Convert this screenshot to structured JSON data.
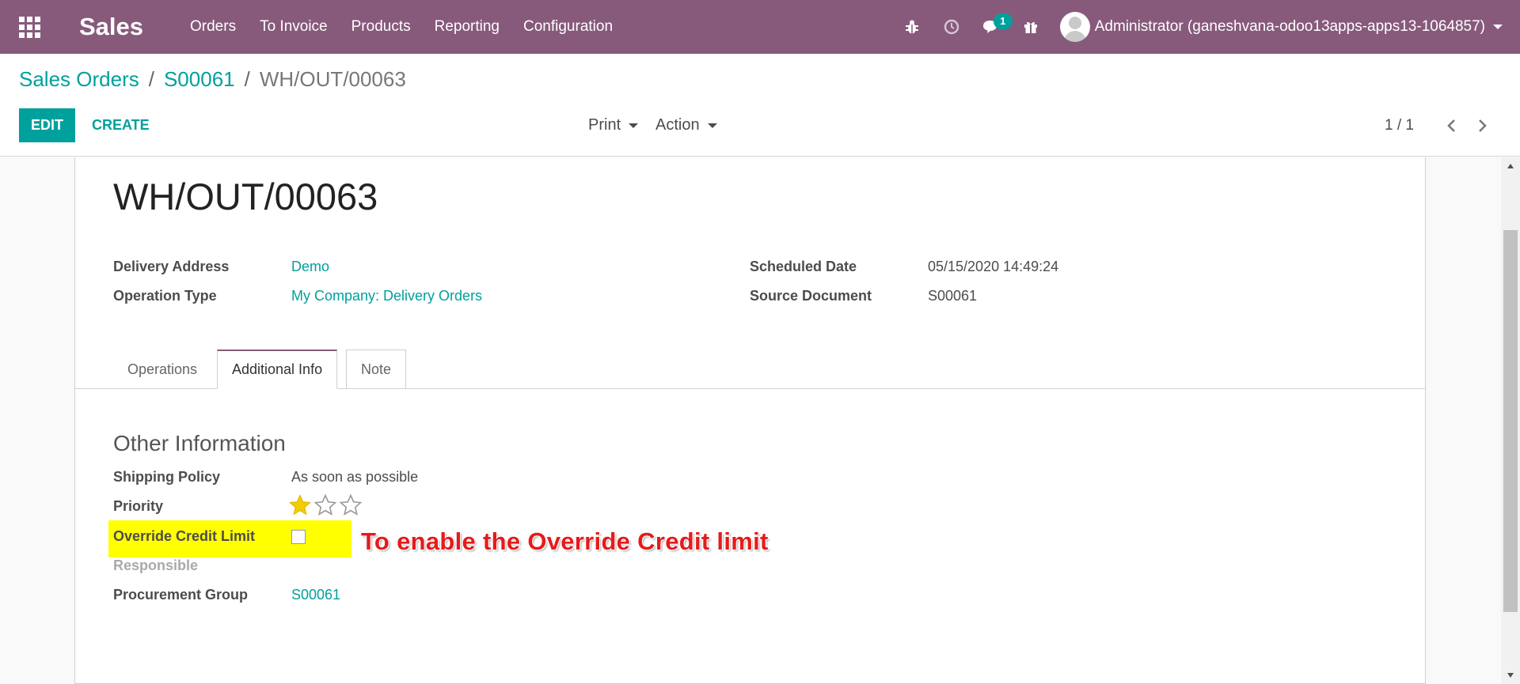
{
  "colors": {
    "brand": "#875a7b",
    "accent": "#00a09d",
    "highlight": "#ffff00",
    "annotation": "#e51b1b"
  },
  "navbar": {
    "app_name": "Sales",
    "menu": [
      "Orders",
      "To Invoice",
      "Products",
      "Reporting",
      "Configuration"
    ],
    "chat_badge": "1",
    "user_label": "Administrator (ganeshvana-odoo13apps-apps13-1064857)",
    "icons": [
      "apps-grid-icon",
      "bug-icon",
      "clock-icon",
      "chat-icon",
      "gift-icon",
      "avatar-icon"
    ]
  },
  "control": {
    "breadcrumb": [
      "Sales Orders",
      "S00061",
      "WH/OUT/00063"
    ],
    "edit_label": "EDIT",
    "create_label": "CREATE",
    "print_label": "Print",
    "action_label": "Action",
    "pager": "1 / 1"
  },
  "record": {
    "title": "WH/OUT/00063",
    "left_fields": [
      {
        "label": "Delivery Address",
        "value": "Demo"
      },
      {
        "label": "Operation Type",
        "value": "My Company: Delivery Orders"
      }
    ],
    "right_fields": [
      {
        "label": "Scheduled Date",
        "value": "05/15/2020 14:49:24"
      },
      {
        "label": "Source Document",
        "value": "S00061"
      }
    ]
  },
  "tabs": [
    {
      "label": "Operations",
      "active": false
    },
    {
      "label": "Additional Info",
      "active": true
    },
    {
      "label": "Note",
      "active": false
    }
  ],
  "additional_info": {
    "section_title": "Other Information",
    "shipping_policy": {
      "label": "Shipping Policy",
      "value": "As soon as possible"
    },
    "priority": {
      "label": "Priority",
      "level": 1,
      "max": 3
    },
    "override_credit_limit": {
      "label": "Override Credit Limit",
      "checked": false
    },
    "responsible": {
      "label": "Responsible",
      "value": ""
    },
    "procurement_group": {
      "label": "Procurement Group",
      "value": "S00061"
    }
  },
  "annotation_text": "To enable the Override Credit limit"
}
